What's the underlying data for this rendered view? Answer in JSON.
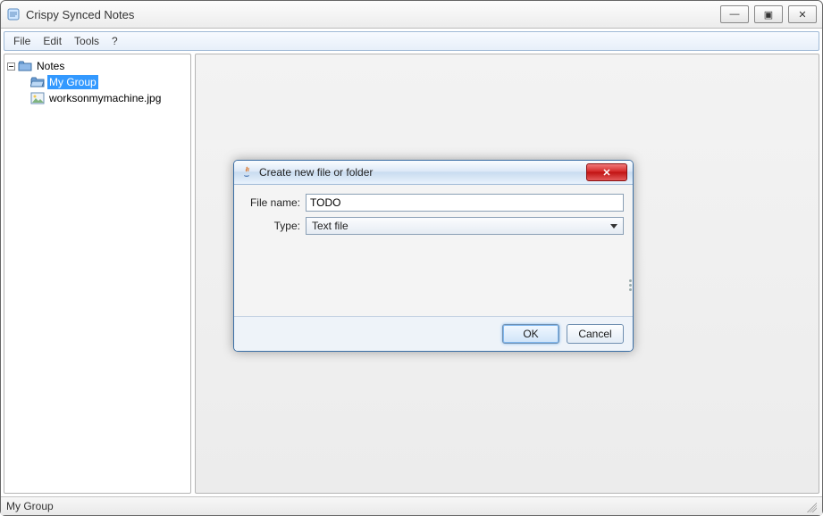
{
  "window": {
    "title": "Crispy Synced Notes",
    "icons": {
      "minimize": "—",
      "maximize": "▣",
      "close": "✕"
    }
  },
  "menu": {
    "items": [
      "File",
      "Edit",
      "Tools",
      "?"
    ]
  },
  "tree": {
    "root": {
      "label": "Notes"
    },
    "children": [
      {
        "label": "My Group",
        "kind": "folder",
        "selected": true
      },
      {
        "label": "worksonmymachine.jpg",
        "kind": "image",
        "selected": false
      }
    ]
  },
  "statusbar": {
    "text": "My Group"
  },
  "dialog": {
    "title": "Create new file or folder",
    "fields": {
      "filename_label": "File name:",
      "filename_value": "TODO",
      "type_label": "Type:",
      "type_value": "Text file",
      "type_options": [
        "Text file"
      ]
    },
    "buttons": {
      "ok": "OK",
      "cancel": "Cancel"
    }
  }
}
